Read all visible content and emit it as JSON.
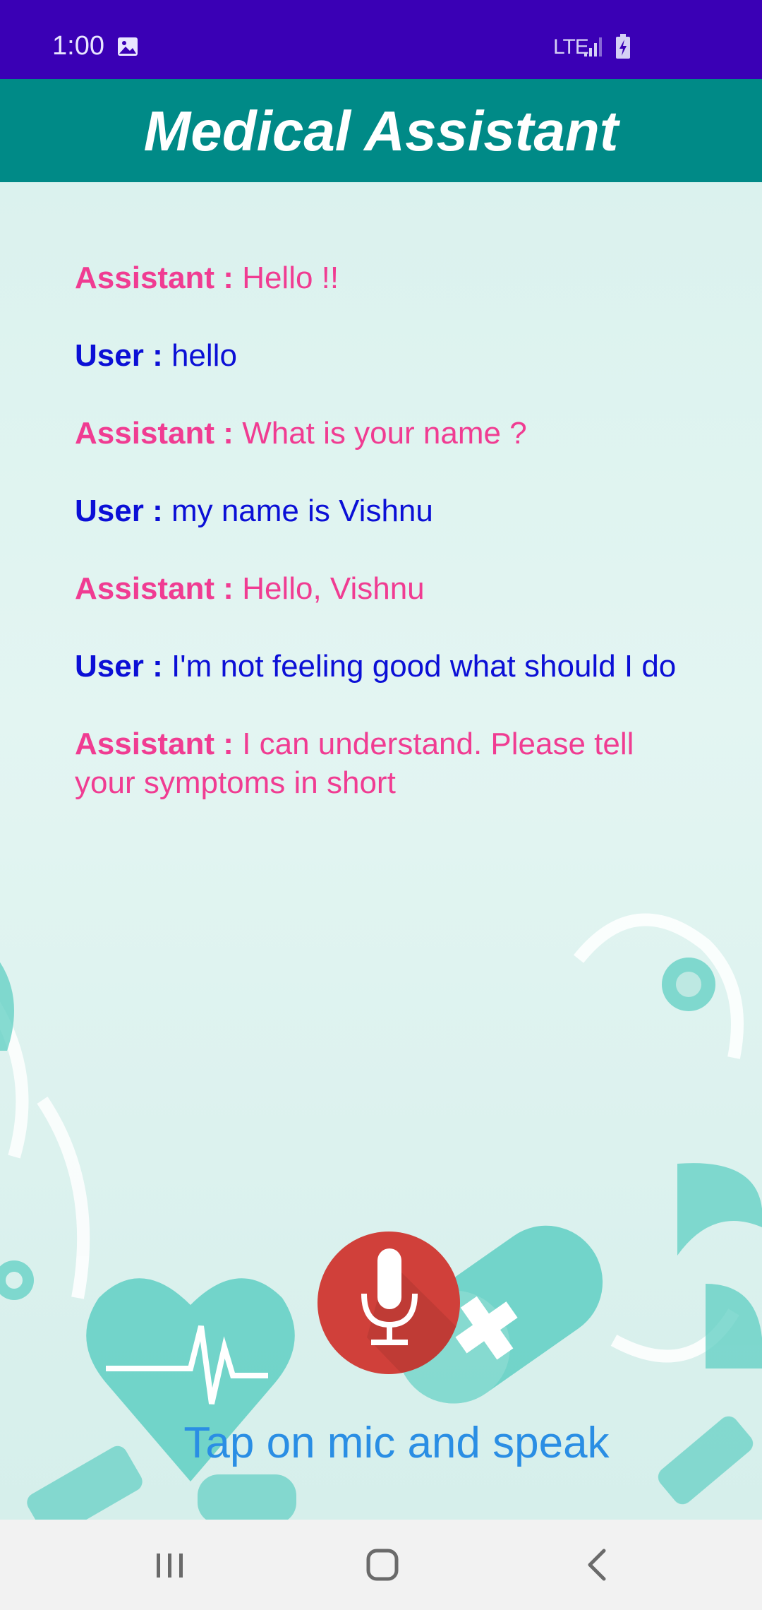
{
  "status_bar": {
    "time": "1:00",
    "network": "LTE",
    "icons": [
      "image-icon",
      "signal-icon",
      "battery-charging-icon"
    ]
  },
  "header": {
    "title": "Medical Assistant",
    "background_color": "#008a87"
  },
  "chat": {
    "messages": [
      {
        "speaker": "Assistant :",
        "text": "Hello !!",
        "role": "assistant"
      },
      {
        "speaker": "User :",
        "text": "hello",
        "role": "user"
      },
      {
        "speaker": "Assistant :",
        "text": "What is your name ?",
        "role": "assistant"
      },
      {
        "speaker": "User :",
        "text": "my name is Vishnu",
        "role": "user"
      },
      {
        "speaker": "Assistant :",
        "text": "Hello, Vishnu",
        "role": "assistant"
      },
      {
        "speaker": "User :",
        "text": "I'm not feeling good what should I do",
        "role": "user"
      },
      {
        "speaker": "Assistant :",
        "text": "I can understand. Please tell your symptoms in short",
        "role": "assistant"
      }
    ],
    "assistant_color": "#f03c92",
    "user_color": "#0b0fd6"
  },
  "mic": {
    "icon": "microphone-icon",
    "color": "#d0403a"
  },
  "hint": "Tap on mic and speak",
  "nav_bar": {
    "icons": [
      "recents-icon",
      "home-icon",
      "back-icon"
    ]
  },
  "colors": {
    "status_bar": "#3a00b5",
    "accent_teal": "#5fcfc3"
  }
}
